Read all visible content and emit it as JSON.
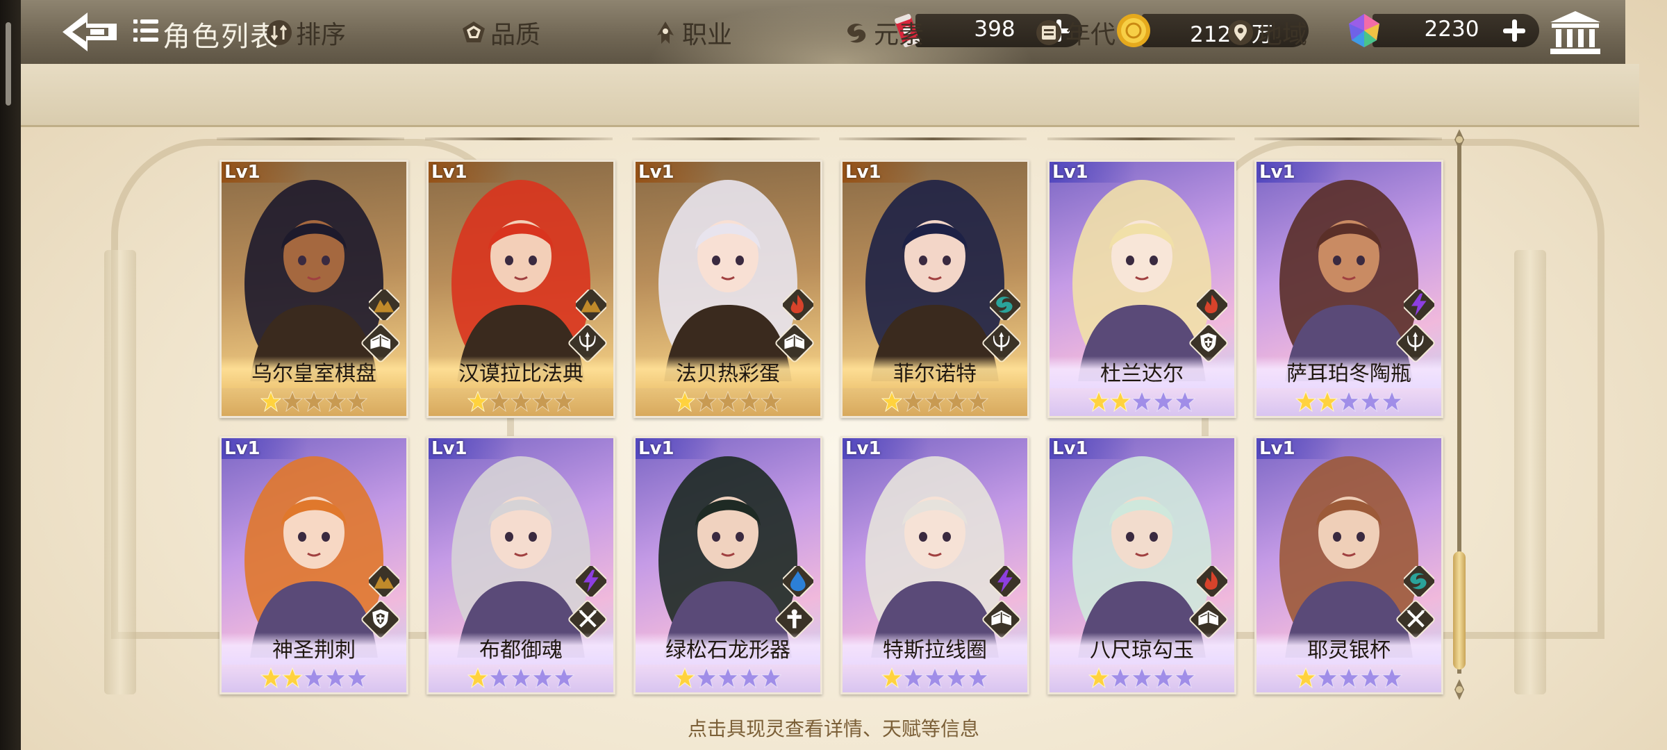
{
  "header": {
    "title": "角色列表",
    "resources": [
      {
        "name": "drink",
        "icon": "drink-can-icon",
        "value": "398"
      },
      {
        "name": "coin",
        "icon": "gold-coin-icon",
        "value": "212.8万"
      },
      {
        "name": "gem",
        "icon": "rainbow-gem-icon",
        "value": "2230"
      }
    ]
  },
  "filters": [
    {
      "label": "排序",
      "icon": "sort-icon"
    },
    {
      "label": "品质",
      "icon": "quality-icon"
    },
    {
      "label": "职业",
      "icon": "class-icon"
    },
    {
      "label": "元素",
      "icon": "element-icon"
    },
    {
      "label": "年代",
      "icon": "era-icon"
    },
    {
      "label": "地域",
      "icon": "location-pin-icon"
    }
  ],
  "cards": [
    {
      "level": "Lv1",
      "name": "乌尔皇室棋盘",
      "stars": 1,
      "rarity": "gold",
      "element": "earth",
      "class": "scholar"
    },
    {
      "level": "Lv1",
      "name": "汉谟拉比法典",
      "stars": 1,
      "rarity": "gold",
      "element": "earth",
      "class": "trident"
    },
    {
      "level": "Lv1",
      "name": "法贝热彩蛋",
      "stars": 1,
      "rarity": "gold",
      "element": "fire",
      "class": "scholar"
    },
    {
      "level": "Lv1",
      "name": "菲尔诺特",
      "stars": 1,
      "rarity": "gold",
      "element": "wind",
      "class": "trident"
    },
    {
      "level": "Lv1",
      "name": "杜兰达尔",
      "stars": 2,
      "rarity": "purple",
      "element": "fire",
      "class": "guardian"
    },
    {
      "level": "Lv1",
      "name": "萨耳珀冬陶瓶",
      "stars": 2,
      "rarity": "purple",
      "element": "thunder",
      "class": "trident"
    },
    {
      "level": "Lv1",
      "name": "神圣荆刺",
      "stars": 2,
      "rarity": "purple",
      "element": "earth",
      "class": "guardian"
    },
    {
      "level": "Lv1",
      "name": "布都御魂",
      "stars": 1,
      "rarity": "purple",
      "element": "thunder",
      "class": "warrior"
    },
    {
      "level": "Lv1",
      "name": "绿松石龙形器",
      "stars": 1,
      "rarity": "purple",
      "element": "water",
      "class": "healer"
    },
    {
      "level": "Lv1",
      "name": "特斯拉线圈",
      "stars": 1,
      "rarity": "purple",
      "element": "thunder",
      "class": "scholar"
    },
    {
      "level": "Lv1",
      "name": "八尺琼勾玉",
      "stars": 1,
      "rarity": "purple",
      "element": "fire",
      "class": "scholar"
    },
    {
      "level": "Lv1",
      "name": "耶灵银杯",
      "stars": 1,
      "rarity": "purple",
      "element": "wind",
      "class": "warrior"
    }
  ],
  "colors": {
    "fire": "#d8432b",
    "earth": "#c08a2a",
    "wind": "#2aa39a",
    "water": "#2c7fd6",
    "thunder": "#8d3fe0",
    "badge_bg": "#3b3327",
    "star_gold": "#ffd23e",
    "star_empty_gold": "#c89a52",
    "star_empty_purple": "#a08de8"
  },
  "hint": "点击具现灵查看详情、天赋等信息"
}
